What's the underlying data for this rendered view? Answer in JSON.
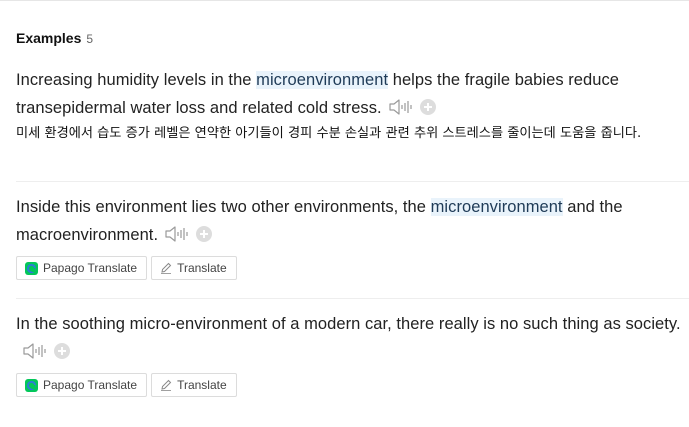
{
  "header": {
    "title": "Examples",
    "count": "5"
  },
  "examples": [
    {
      "before": "Increasing humidity levels in the ",
      "highlight": "microenvironment",
      "after": " helps the fragile babies reduce transepidermal water loss and related cold stress.",
      "translation": "미세 환경에서 습도 증가 레벨은 연약한 아기들이 경피 수분 손실과 관련 추위 스트레스를 줄이는데 도움을 줍니다."
    },
    {
      "before": "Inside this environment lies two other environments, the ",
      "highlight": "microenvironment",
      "after": " and the macroenvironment.",
      "buttons": {
        "papago": "Papago Translate",
        "translate": "Translate"
      }
    },
    {
      "before": "In the soothing micro-environment of a modern car, there really is no such thing as society.",
      "buttons": {
        "papago": "Papago Translate",
        "translate": "Translate"
      }
    }
  ],
  "colors": {
    "highlight_bg": "#e9f3fb",
    "papago_green": "#03c75a",
    "papago_blue": "#2e7bd6"
  },
  "icons": [
    "speaker-icon",
    "add-icon",
    "papago-logo-icon",
    "pencil-icon"
  ]
}
